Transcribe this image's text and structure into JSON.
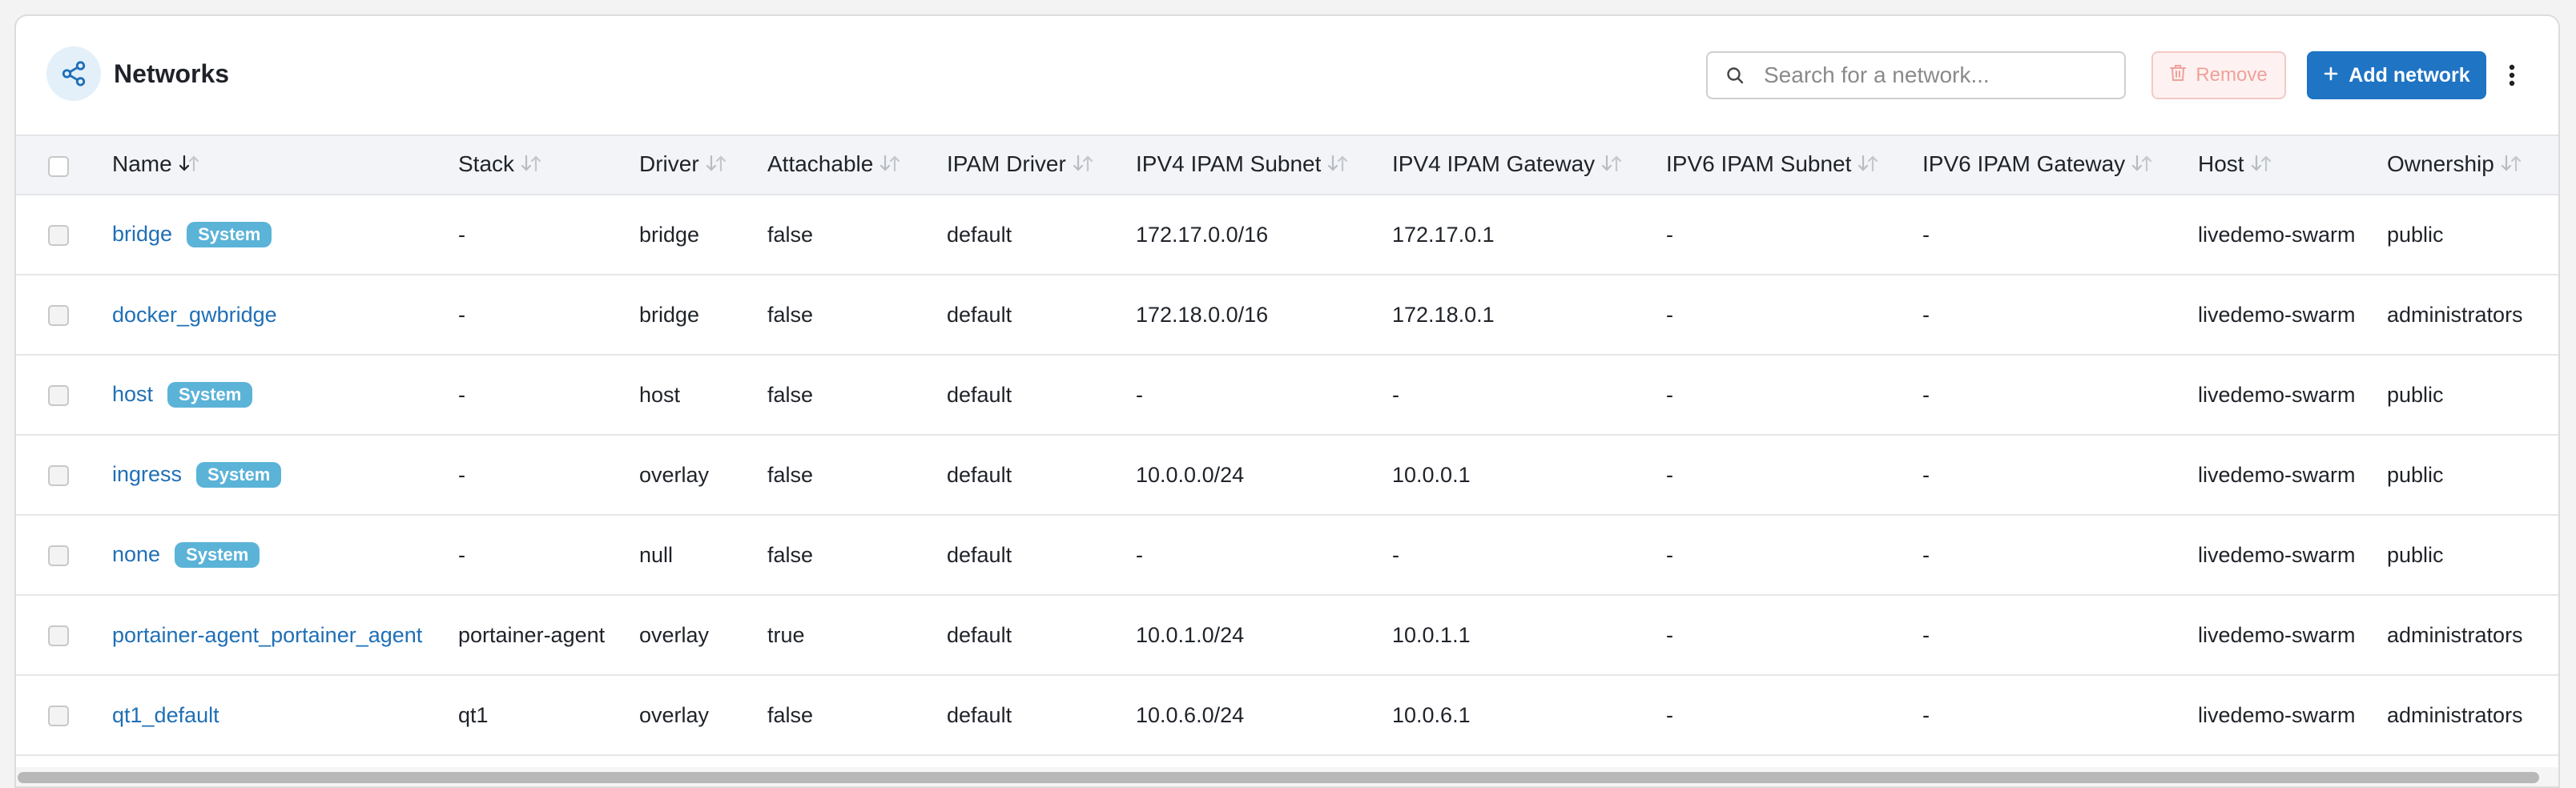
{
  "header": {
    "title": "Networks",
    "icon": "share-icon",
    "search_placeholder": "Search for a network...",
    "remove_label": "Remove",
    "add_label": "Add network"
  },
  "columns": [
    "Name",
    "Stack",
    "Driver",
    "Attachable",
    "IPAM Driver",
    "IPV4 IPAM Subnet",
    "IPV4 IPAM Gateway",
    "IPV6 IPAM Subnet",
    "IPV6 IPAM Gateway",
    "Host",
    "Ownership"
  ],
  "rows": [
    {
      "name": "bridge",
      "badge": "System",
      "stack": "-",
      "driver": "bridge",
      "attachable": "false",
      "ipam_driver": "default",
      "ipv4_subnet": "172.17.0.0/16",
      "ipv4_gateway": "172.17.0.1",
      "ipv6_subnet": "-",
      "ipv6_gateway": "-",
      "host": "livedemo-swarm",
      "ownership": "public"
    },
    {
      "name": "docker_gwbridge",
      "badge": "",
      "stack": "-",
      "driver": "bridge",
      "attachable": "false",
      "ipam_driver": "default",
      "ipv4_subnet": "172.18.0.0/16",
      "ipv4_gateway": "172.18.0.1",
      "ipv6_subnet": "-",
      "ipv6_gateway": "-",
      "host": "livedemo-swarm",
      "ownership": "administrators"
    },
    {
      "name": "host",
      "badge": "System",
      "stack": "-",
      "driver": "host",
      "attachable": "false",
      "ipam_driver": "default",
      "ipv4_subnet": "-",
      "ipv4_gateway": "-",
      "ipv6_subnet": "-",
      "ipv6_gateway": "-",
      "host": "livedemo-swarm",
      "ownership": "public"
    },
    {
      "name": "ingress",
      "badge": "System",
      "stack": "-",
      "driver": "overlay",
      "attachable": "false",
      "ipam_driver": "default",
      "ipv4_subnet": "10.0.0.0/24",
      "ipv4_gateway": "10.0.0.1",
      "ipv6_subnet": "-",
      "ipv6_gateway": "-",
      "host": "livedemo-swarm",
      "ownership": "public"
    },
    {
      "name": "none",
      "badge": "System",
      "stack": "-",
      "driver": "null",
      "attachable": "false",
      "ipam_driver": "default",
      "ipv4_subnet": "-",
      "ipv4_gateway": "-",
      "ipv6_subnet": "-",
      "ipv6_gateway": "-",
      "host": "livedemo-swarm",
      "ownership": "public"
    },
    {
      "name": "portainer-agent_portainer_agent",
      "badge": "",
      "stack": "portainer-agent",
      "driver": "overlay",
      "attachable": "true",
      "ipam_driver": "default",
      "ipv4_subnet": "10.0.1.0/24",
      "ipv4_gateway": "10.0.1.1",
      "ipv6_subnet": "-",
      "ipv6_gateway": "-",
      "host": "livedemo-swarm",
      "ownership": "administrators"
    },
    {
      "name": "qt1_default",
      "badge": "",
      "stack": "qt1",
      "driver": "overlay",
      "attachable": "false",
      "ipam_driver": "default",
      "ipv4_subnet": "10.0.6.0/24",
      "ipv4_gateway": "10.0.6.1",
      "ipv6_subnet": "-",
      "ipv6_gateway": "-",
      "host": "livedemo-swarm",
      "ownership": "administrators"
    }
  ],
  "colors": {
    "accent": "#1f74c4",
    "link": "#1f6fb6",
    "badge": "#5bb3d8",
    "remove_text": "#f0a19a"
  }
}
